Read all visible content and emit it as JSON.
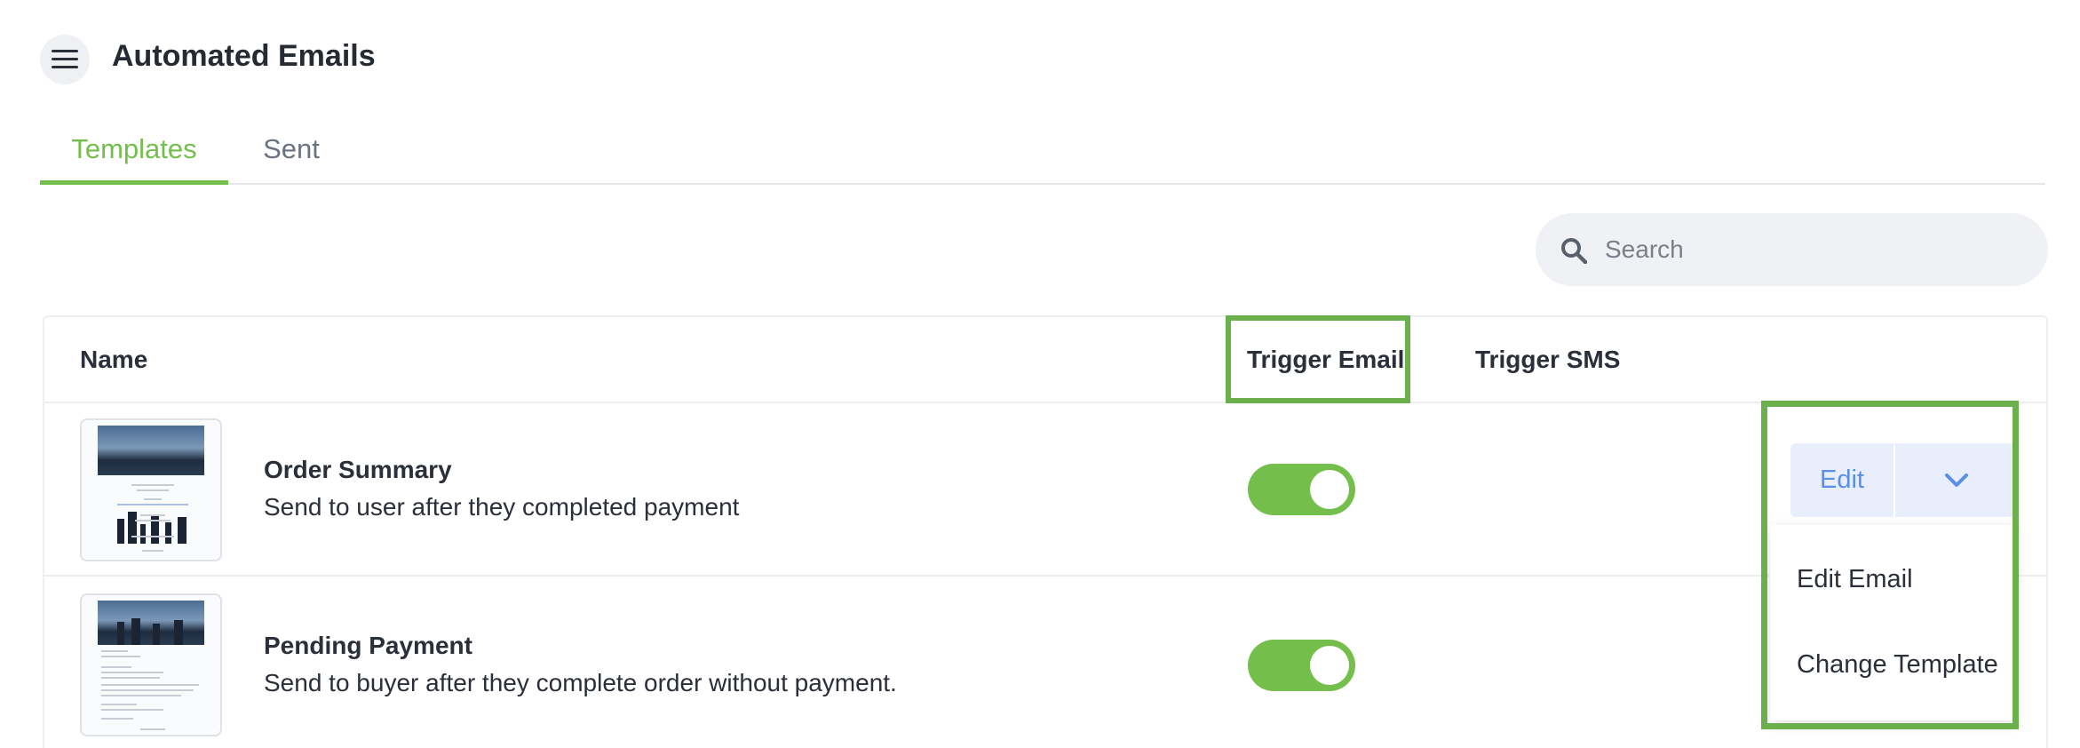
{
  "header": {
    "title": "Automated Emails"
  },
  "tabs": [
    {
      "label": "Templates",
      "active": true
    },
    {
      "label": "Sent",
      "active": false
    }
  ],
  "search": {
    "placeholder": "Search",
    "value": ""
  },
  "table": {
    "columns": [
      "Name",
      "Trigger Email",
      "Trigger SMS"
    ],
    "rows": [
      {
        "title": "Order Summary",
        "description": "Send to user after they completed payment",
        "trigger_email": true
      },
      {
        "title": "Pending Payment",
        "description": "Send to buyer after they complete order without payment.",
        "trigger_email": true
      }
    ]
  },
  "actions": {
    "edit_label": "Edit",
    "menu": [
      "Edit Email",
      "Change Template"
    ]
  },
  "colors": {
    "accent_green": "#74bf4c",
    "highlight_green": "#6ab04c",
    "edit_blue": "#5b8fe6",
    "edit_bg": "#e8eefb"
  },
  "icons": [
    "menu-icon",
    "search-icon",
    "chevron-down-icon",
    "email-thumbnail"
  ]
}
